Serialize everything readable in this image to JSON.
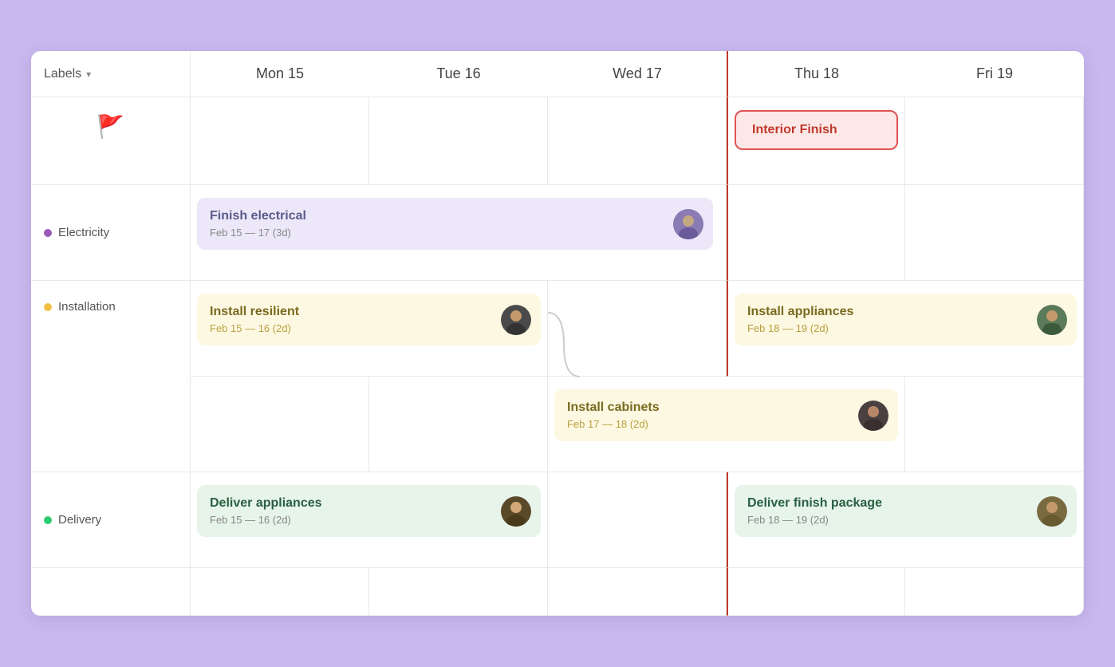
{
  "header": {
    "labels": "Labels",
    "days": [
      "Mon 15",
      "Tue 16",
      "Wed 17",
      "Thu 18",
      "Fri 19"
    ]
  },
  "rows": {
    "flag": {
      "label": "",
      "tasks": {
        "thu": {
          "title": "Interior Finish",
          "style": "red-outline"
        }
      }
    },
    "electricity": {
      "label": "Electricity",
      "dot_color": "#9b59b6",
      "tasks": {
        "mon_to_wed": {
          "title": "Finish electrical",
          "date": "Feb 15 — 17 (3d)",
          "style": "purple"
        }
      }
    },
    "installation": {
      "label": "Installation",
      "dot_color": "#f0c040",
      "tasks": {
        "mon_to_tue": {
          "title": "Install resilient",
          "date": "Feb 15 — 16 (2d)",
          "style": "yellow"
        },
        "wed_to_thu": {
          "title": "Install cabinets",
          "date": "Feb 17 — 18 (2d)",
          "style": "yellow"
        },
        "thu_to_fri": {
          "title": "Install appliances",
          "date": "Feb 18 — 19 (2d)",
          "style": "yellow"
        }
      }
    },
    "delivery": {
      "label": "Delivery",
      "dot_color": "#2ecc71",
      "tasks": {
        "mon_to_tue": {
          "title": "Deliver appliances",
          "date": "Feb 15 — 16 (2d)",
          "style": "green"
        },
        "thu_to_fri": {
          "title": "Deliver finish package",
          "date": "Feb 18 — 19 (2d)",
          "style": "green"
        }
      }
    }
  }
}
